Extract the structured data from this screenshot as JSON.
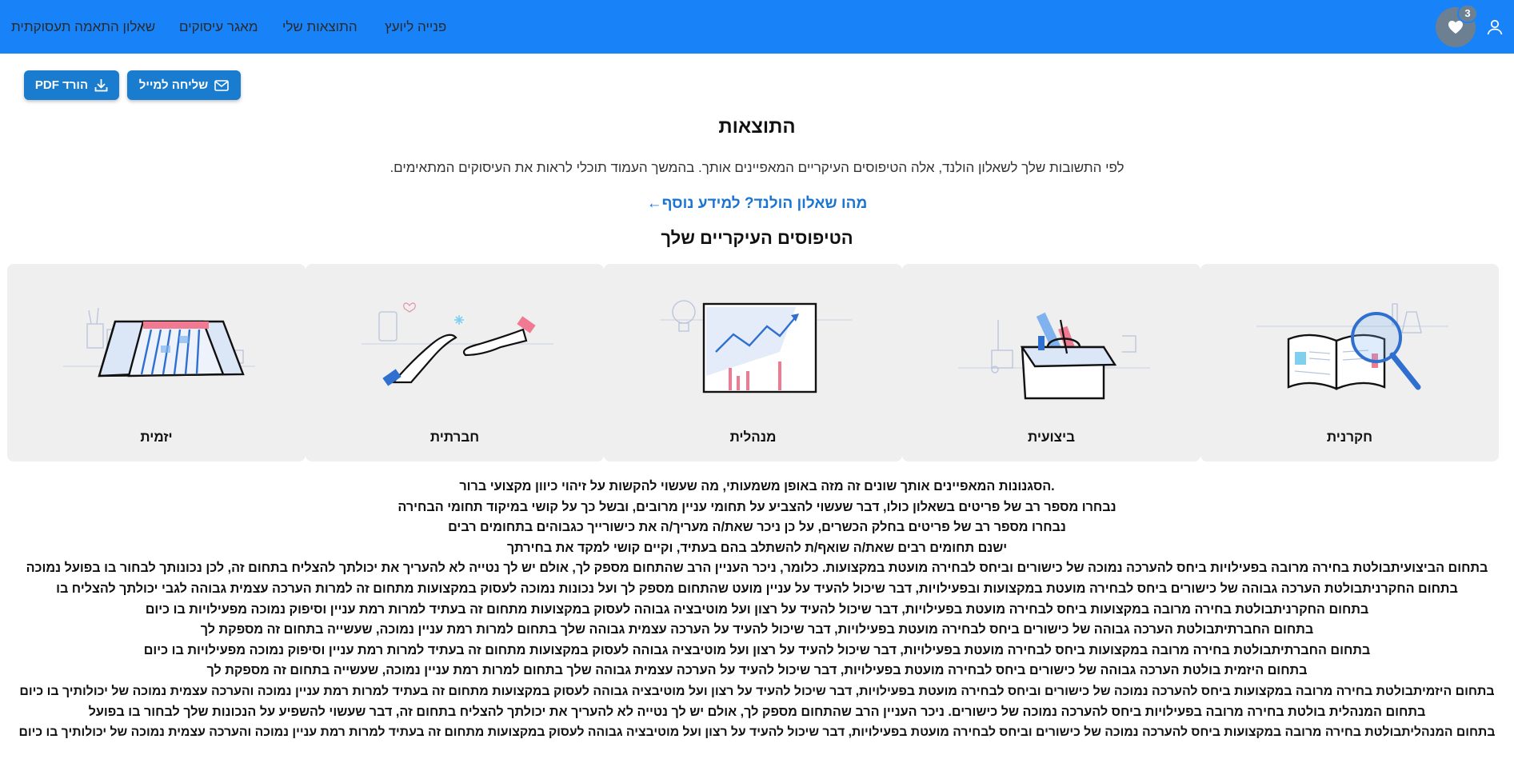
{
  "nav": {
    "items": [
      {
        "label": "פנייה ליועץ"
      },
      {
        "label": "התוצאות שלי"
      },
      {
        "label": "מאגר עיסוקים"
      },
      {
        "label": "שאלון התאמה תעסוקתית"
      }
    ],
    "favorites_count": "3",
    "colors": {
      "bar": "#1882f8",
      "fav": "#6c8092"
    }
  },
  "actions": {
    "mail_label": "שליחה למייל",
    "pdf_label": "הורד PDF"
  },
  "page": {
    "title": "התוצאות",
    "intro": "לפי התשובות שלך לשאלון הולנד, אלה הטיפוסים העיקריים המאפיינים אותך. בהמשך העמוד תוכלי לראות את העיסוקים המתאימים.",
    "more_link": "מהו שאלון הולנד? למידע נוסף←",
    "subtitle": "הטיפוסים העיקריים שלך"
  },
  "types": [
    {
      "label": "חקרנית",
      "icon": "book-magnifier-icon"
    },
    {
      "label": "ביצועית",
      "icon": "toolbox-icon"
    },
    {
      "label": "מנהלית",
      "icon": "chart-board-icon"
    },
    {
      "label": "חברתית",
      "icon": "handshake-icon"
    },
    {
      "label": "יזמית",
      "icon": "calendar-icon"
    }
  ],
  "description": [
    ".הסגנונות המאפיינים אותך שונים זה מזה באופן משמעותי, מה שעשוי להקשות על זיהוי כיוון מקצועי ברור",
    "נבחרו מספר רב של פריטים בשאלון כולו, דבר שעשוי להצביע על תחומי עניין מרובים, ובשל כך על קושי במיקוד תחומי הבחירה",
    "נבחרו מספר רב של פריטים בחלק הכשרים, על כן ניכר שאת/ה מעריך/ה את כישורייך כגבוהים בתחומים רבים",
    "ישנם תחומים רבים שאת/ה שואף/ת להשתלב בהם בעתיד, וקיים קושי למקד את בחירתך",
    "בתחום הביצועיתבולטת בחירה מרובה בפעילויות ביחס להערכה נמוכה של כישורים וביחס לבחירה מועטת במקצועות. כלומר, ניכר העניין הרב שהתחום מספק לך, אולם יש לך נטייה לא להעריך את יכולתך להצליח בתחום זה, לכן נכונותך לבחור בו בפועל נמוכה",
    "בתחום החקרניתבולטת הערכה גבוהה של כישורים ביחס לבחירה מועטת במקצועות ובפעילויות, דבר שיכול להעיד על עניין מועט שהתחום מספק לך ועל נכונות נמוכה לעסוק במקצועות מתחום זה למרות הערכה עצמית גבוהה לגבי יכולתך להצליח בו",
    "בתחום החקרניתבולטת בחירה מרובה במקצועות ביחס לבחירה מועטת בפעילויות, דבר שיכול להעיד על רצון ועל מוטיבציה גבוהה לעסוק במקצועות מתחום זה בעתיד למרות רמת עניין וסיפוק נמוכה מפעילויות בו כיום",
    "בתחום החברתיתבולטת הערכה גבוהה של כישורים ביחס לבחירה מועטת בפעילויות, דבר שיכול להעיד על הערכה עצמית גבוהה שלך בתחום למרות רמת עניין נמוכה, שעשייה בתחום זה מספקת לך",
    "בתחום החברתיתבולטת בחירה מרובה במקצועות ביחס לבחירה מועטת בפעילויות, דבר שיכול להעיד על רצון ועל מוטיבציה גבוהה לעסוק במקצועות מתחום זה בעתיד למרות רמת עניין וסיפוק נמוכה מפעילויות בו כיום",
    "בתחום היזמית בולטת הערכה גבוהה של כישורים ביחס לבחירה מועטת בפעילויות, דבר שיכול להעיד על הערכה עצמית גבוהה שלך בתחום למרות רמת עניין נמוכה, שעשייה בתחום זה מספקת לך",
    "בתחום היזמיתבולטת בחירה מרובה במקצועות ביחס להערכה נמוכה של כישורים וביחס לבחירה מועטת בפעילויות, דבר שיכול להעיד על רצון ועל מוטיבציה גבוהה לעסוק במקצועות מתחום זה בעתיד למרות רמת עניין נמוכה והערכה עצמית נמוכה של יכולותיך בו כיום",
    "בתחום המנהלית בולטת בחירה מרובה בפעילויות ביחס להערכה נמוכה של כישורים. ניכר העניין הרב שהתחום מספק לך, אולם יש לך נטייה לא להעריך את יכולתך להצליח בתחום זה, דבר שעשוי להשפיע על הנכונות שלך לבחור בו בפועל",
    "בתחום המנהליתבולטת בחירה מרובה במקצועות ביחס להערכה נמוכה של כישורים וביחס לבחירה מועטת בפעילויות, דבר שיכול להעיד על רצון ועל מוטיבציה גבוהה לעסוק במקצועות מתחום זה בעתיד למרות רמת עניין נמוכה והערכה עצמית נמוכה של יכולותיך בו כיום"
  ]
}
